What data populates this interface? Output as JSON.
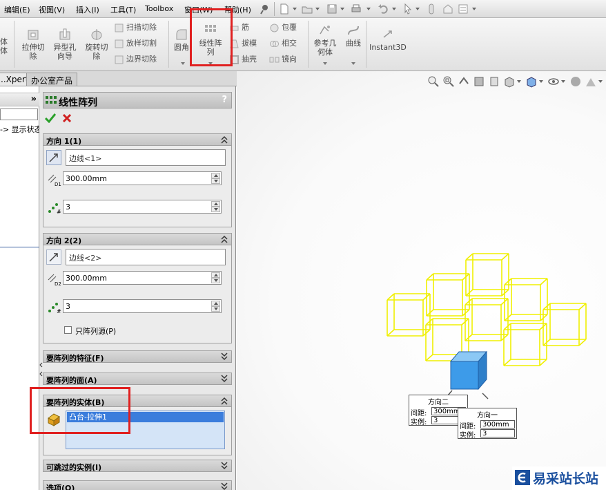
{
  "menubar": {
    "items": [
      "编辑(E)",
      "视图(V)",
      "插入(I)",
      "工具(T)",
      "Toolbox",
      "窗口(W)",
      "帮助(H)"
    ]
  },
  "ribbon": {
    "left_cut": "体\n体",
    "extrude_cut": "拉伸切\n除",
    "hole_wizard": "异型孔\n向导",
    "revolve_cut": "旋转切\n除",
    "sweep_cut": "扫描切除",
    "loft_cut": "放样切割",
    "boundary_cut": "边界切除",
    "fillet": "圆角",
    "linear_pattern": "线性阵\n列",
    "rib": "筋",
    "draft": "拔模",
    "shell": "抽壳",
    "wrap": "包覆",
    "intersect": "相交",
    "mirror": "镜向",
    "ref_geometry": "参考几\n何体",
    "curves": "曲线",
    "instant3d": "Instant3D"
  },
  "tabs": [
    "..Xpert",
    "办公室产品"
  ],
  "tree": {
    "collapse": "»",
    "item": "-> 显示状态"
  },
  "pm": {
    "title": "线性阵列",
    "help": "?",
    "dir1": {
      "header": "方向 1(1)",
      "edge": "边线<1>",
      "spacing": "300.00mm",
      "count": "3"
    },
    "dir2": {
      "header": "方向 2(2)",
      "edge": "边线<2>",
      "spacing": "300.00mm",
      "count": "3",
      "seed_only": "只阵列源(P)"
    },
    "features_header": "要阵列的特征(F)",
    "faces_header": "要阵列的面(A)",
    "bodies": {
      "header": "要阵列的实体(B)",
      "item": "凸台-拉伸1"
    },
    "skip_header": "可跳过的实例(I)",
    "options_header": "选项(O)"
  },
  "callouts": {
    "dir2": {
      "title": "方向二",
      "spacing_label": "间距:",
      "spacing": "300mm",
      "count_label": "实例:",
      "count": "3"
    },
    "dir1": {
      "title": "方向一",
      "spacing_label": "间距:",
      "spacing": "300mm",
      "count_label": "实例:",
      "count": "3"
    }
  },
  "watermark": {
    "text": "易采站长站"
  },
  "colors": {
    "preview": "#f0f000",
    "body": "#3d9be9",
    "highlight": "#e02020",
    "selection": "#3b7ddc"
  }
}
